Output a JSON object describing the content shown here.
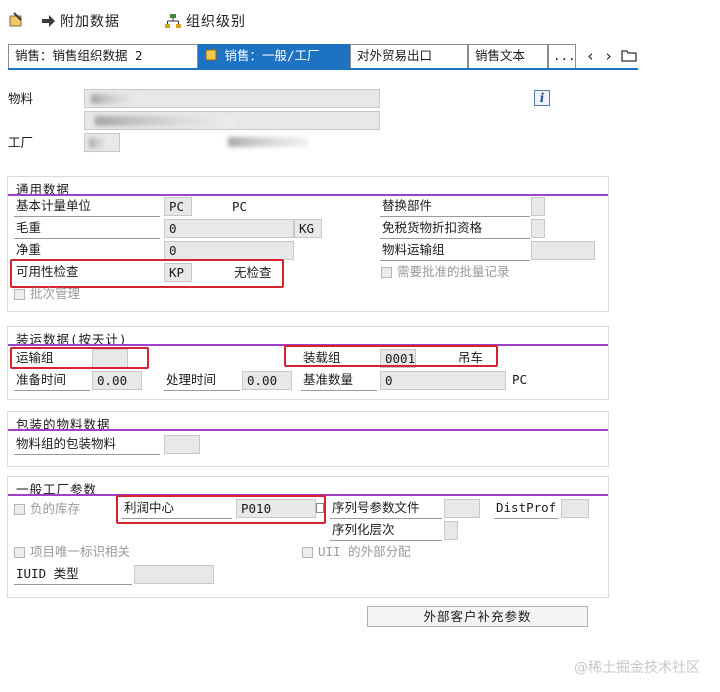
{
  "toolbar": {
    "items": [
      {
        "label": ""
      },
      {
        "label": "附加数据"
      },
      {
        "label": "组织级别"
      }
    ]
  },
  "tabs": [
    {
      "label": "销售：销售组织数据 2"
    },
    {
      "label": "销售：一般/工厂"
    },
    {
      "label": "对外贸易出口"
    },
    {
      "label": "销售文本"
    },
    {
      "label": "..."
    }
  ],
  "header": {
    "material_label": "物料",
    "plant_label": "工厂",
    "info_label": "i"
  },
  "general": {
    "title": "通用数据",
    "base_unit_label": "基本计量单位",
    "base_unit_value": "PC",
    "base_unit_text": "PC",
    "gross_weight_label": "毛重",
    "gross_weight_value": "0",
    "weight_unit": "KG",
    "net_weight_label": "净重",
    "net_weight_value": "0",
    "availability_label": "可用性检查",
    "availability_value": "KP",
    "availability_text": "无检查",
    "batch_label": "批次管理",
    "replacement_label": "替换部件",
    "dutyfree_label": "免税货物折扣资格",
    "transport_group_label": "物料运输组",
    "approved_batch_label": "需要批准的批量记录"
  },
  "shipping": {
    "title": "装运数据(按天计)",
    "transport_group_label": "运输组",
    "loading_group_label": "装载组",
    "loading_group_value": "0001",
    "loading_group_text": "吊车",
    "setup_time_label": "准备时间",
    "setup_time_value": "0.00",
    "proc_time_label": "处理时间",
    "proc_time_value": "0.00",
    "base_qty_label": "基准数量",
    "base_qty_value": "0",
    "base_qty_unit": "PC"
  },
  "packaging": {
    "title": "包装的物料数据",
    "pack_material_label": "物料组的包装物料"
  },
  "plant_params": {
    "title": "一般工厂参数",
    "neg_stock_label": "负的库存",
    "profit_center_label": "利润中心",
    "profit_center_value": "P010",
    "serial_profile_label": "序列号参数文件",
    "distprof_label": "DistProf",
    "serial_level_label": "序列化层次",
    "unique_item_label": "项目唯一标识相关",
    "uii_label": "UII 的外部分配",
    "iuid_label": "IUID 类型"
  },
  "ext_button": {
    "label": "外部客户补充参数"
  },
  "watermark": "@稀土掘金技术社区",
  "colors": {
    "tab_active": "#1e72c4",
    "group_line": "#a040c8",
    "highlight": "#d7232f"
  }
}
